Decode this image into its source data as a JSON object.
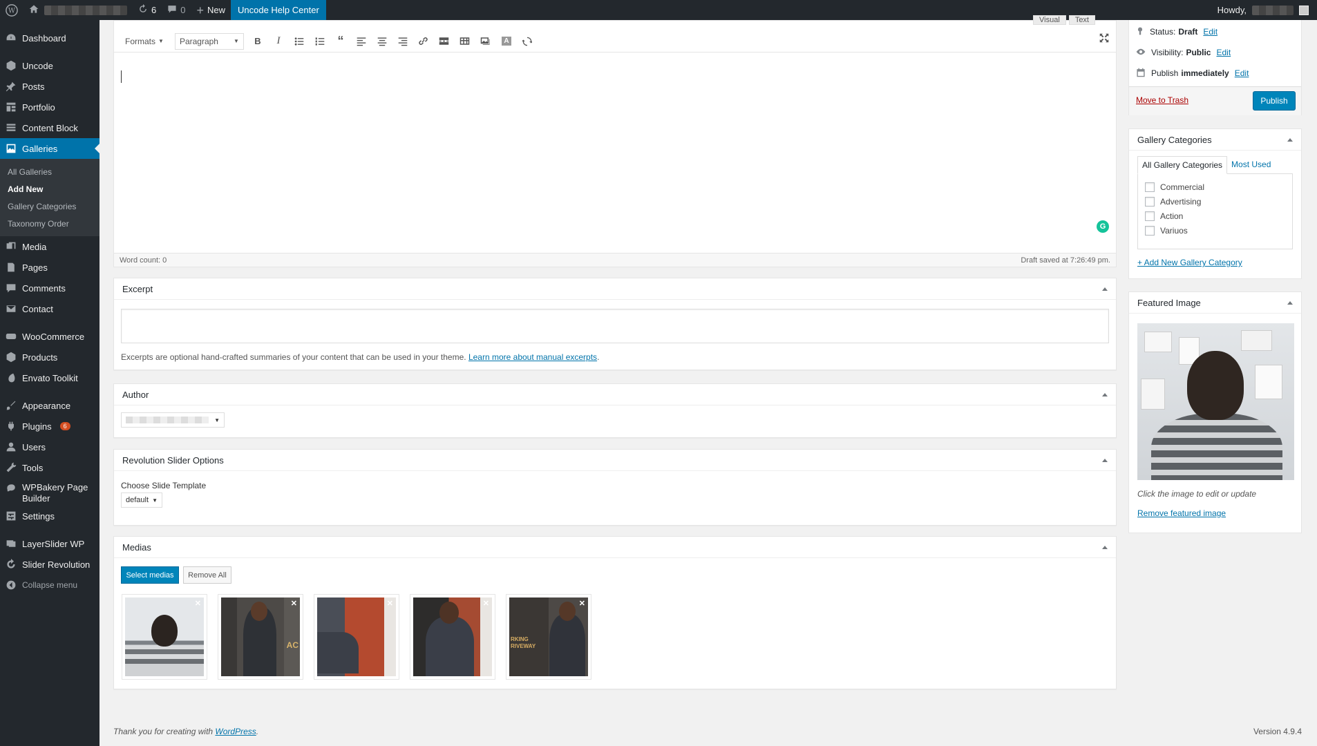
{
  "adminbar": {
    "updates_count": "6",
    "comments_count": "0",
    "new_label": "New",
    "help_label": "Uncode Help Center",
    "howdy_label": "Howdy,"
  },
  "sidebar": {
    "items": [
      {
        "label": "Dashboard",
        "icon": "dashboard-icon"
      },
      {
        "label": "Uncode",
        "icon": "uncode-icon"
      },
      {
        "label": "Posts",
        "icon": "pin-icon"
      },
      {
        "label": "Portfolio",
        "icon": "portfolio-icon"
      },
      {
        "label": "Content Block",
        "icon": "content-block-icon"
      },
      {
        "label": "Galleries",
        "icon": "gallery-icon"
      },
      {
        "label": "Media",
        "icon": "media-icon"
      },
      {
        "label": "Pages",
        "icon": "pages-icon"
      },
      {
        "label": "Comments",
        "icon": "comments-icon"
      },
      {
        "label": "Contact",
        "icon": "mail-icon"
      },
      {
        "label": "WooCommerce",
        "icon": "woocommerce-icon"
      },
      {
        "label": "Products",
        "icon": "products-icon"
      },
      {
        "label": "Envato Toolkit",
        "icon": "envato-icon"
      },
      {
        "label": "Appearance",
        "icon": "brush-icon"
      },
      {
        "label": "Plugins",
        "icon": "plugin-icon",
        "badge": "6"
      },
      {
        "label": "Users",
        "icon": "users-icon"
      },
      {
        "label": "Tools",
        "icon": "tools-icon"
      },
      {
        "label": "WPBakery Page Builder",
        "icon": "wpbakery-icon"
      },
      {
        "label": "Settings",
        "icon": "settings-icon"
      },
      {
        "label": "LayerSlider WP",
        "icon": "layerslider-icon"
      },
      {
        "label": "Slider Revolution",
        "icon": "refresh-icon"
      },
      {
        "label": "Collapse menu",
        "icon": "collapse-icon"
      }
    ],
    "submenu": [
      "All Galleries",
      "Add New",
      "Gallery Categories",
      "Taxonomy Order"
    ]
  },
  "editor": {
    "tab_visual": "Visual",
    "tab_text": "Text",
    "formats_label": "Formats",
    "paragraph_label": "Paragraph",
    "word_count": "Word count: 0",
    "draft_saved": "Draft saved at 7:26:49 pm."
  },
  "excerpt": {
    "title": "Excerpt",
    "help": "Excerpts are optional hand-crafted summaries of your content that can be used in your theme.",
    "link": "Learn more about manual excerpts",
    "link_suffix": "."
  },
  "author": {
    "title": "Author"
  },
  "revslider": {
    "title": "Revolution Slider Options",
    "label": "Choose Slide Template",
    "selected": "default"
  },
  "medias": {
    "title": "Medias",
    "select_label": "Select medias",
    "remove_label": "Remove All",
    "item_count": 5
  },
  "publish": {
    "status_label": "Status:",
    "status_value": "Draft",
    "visibility_label": "Visibility:",
    "visibility_value": "Public",
    "publish_label": "Publish",
    "publish_value": "immediately",
    "edit_label": "Edit",
    "trash_label": "Move to Trash",
    "publish_button": "Publish"
  },
  "gallery_categories": {
    "title": "Gallery Categories",
    "tab_all": "All Gallery Categories",
    "tab_most": "Most Used",
    "items": [
      "Commercial",
      "Advertising",
      "Action",
      "Variuos"
    ],
    "add_new": "+ Add New Gallery Category"
  },
  "featured_image": {
    "title": "Featured Image",
    "hint": "Click the image to edit or update",
    "remove": "Remove featured image"
  },
  "footer": {
    "thanks": "Thank you for creating with",
    "wp_link": "WordPress",
    "thanks_suffix": ".",
    "version": "Version 4.9.4"
  },
  "colors": {
    "adminbar_bg": "#23282d",
    "accent": "#0073aa",
    "primary_button": "#0085ba",
    "badge": "#d54e21",
    "grammarly": "#15c39a"
  }
}
